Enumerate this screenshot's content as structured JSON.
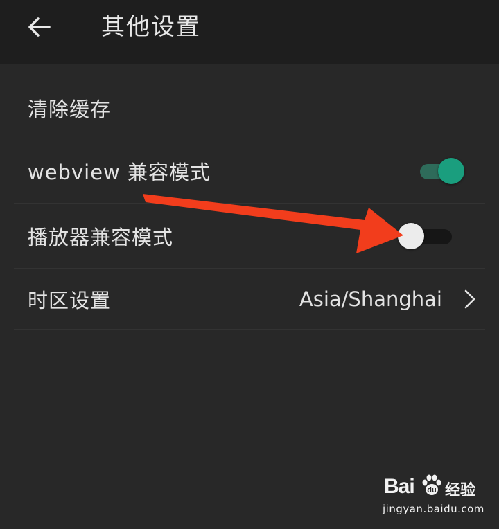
{
  "header": {
    "title": "其他设置",
    "back_icon": "arrow-left-icon"
  },
  "settings": {
    "clear_cache": {
      "label": "清除缓存"
    },
    "webview_compat": {
      "label": "webview 兼容模式",
      "enabled": true
    },
    "player_compat": {
      "label": "播放器兼容模式",
      "enabled": false
    },
    "timezone": {
      "label": "时区设置",
      "value": "Asia/Shanghai",
      "chevron_icon": "chevron-right-icon"
    }
  },
  "colors": {
    "background": "#282828",
    "app_bar": "#1e1e1e",
    "accent": "#1a9e7e",
    "accent_track": "#2e6b5a",
    "thumb_off": "#ececec",
    "track_off": "#161616",
    "annotation_arrow": "#f23d1c"
  },
  "watermark": {
    "logo_text": "Bai",
    "logo_text_2": "经验",
    "url": "jingyan.baidu.com"
  }
}
